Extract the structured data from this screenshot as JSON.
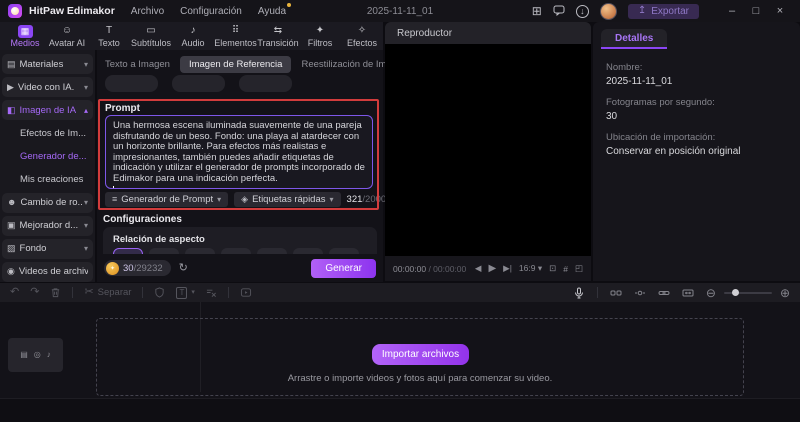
{
  "titlebar": {
    "app_name": "HitPaw Edimakor",
    "menu_archivo": "Archivo",
    "menu_configuracion": "Configuración",
    "menu_ayuda": "Ayuda",
    "document_title": "2025-11-11_01",
    "export_label": "Exportar"
  },
  "ribbon": {
    "tabs": [
      {
        "label": "Medios",
        "icon": "▦"
      },
      {
        "label": "Avatar AI",
        "icon": "☺"
      },
      {
        "label": "Texto",
        "icon": "T"
      },
      {
        "label": "Subtítulos",
        "icon": "▭"
      },
      {
        "label": "Audio",
        "icon": "♪"
      },
      {
        "label": "Elementos",
        "icon": "⠿"
      },
      {
        "label": "Transición",
        "icon": "⇆"
      },
      {
        "label": "Filtros",
        "icon": "✦"
      },
      {
        "label": "Efectos",
        "icon": "✧"
      }
    ]
  },
  "sidebar": {
    "items": [
      {
        "label": "Materiales",
        "icon": "▤",
        "caret": "▾"
      },
      {
        "label": "Video con IA.",
        "icon": "▶",
        "caret": "▾"
      },
      {
        "label": "Imagen de IA",
        "icon": "◧",
        "caret": "▴"
      },
      {
        "label": "Efectos de Im..."
      },
      {
        "label": "Generador de..."
      },
      {
        "label": "Mis creaciones"
      },
      {
        "label": "Cambio de ro...",
        "icon": "☻",
        "caret": "▾"
      },
      {
        "label": "Mejorador d...",
        "icon": "▣",
        "caret": "▾"
      },
      {
        "label": "Fondo",
        "icon": "▨",
        "caret": "▾"
      },
      {
        "label": "Videos de archivo",
        "icon": "◉"
      }
    ]
  },
  "media_panel": {
    "subtab_texto": "Texto a Imagen",
    "subtab_referencia": "Imagen de Referencia",
    "subtab_reestilizacion": "Reestilización de Imag...",
    "prompt_title": "Prompt",
    "prompt_text": "Una hermosa escena iluminada suavemente de una pareja disfrutando de un beso. Fondo: una playa al atardecer con un horizonte brillante. Para efectos más realistas e impresionantes, también puedes añadir etiquetas de indicación y utilizar el generador de prompts incorporado de Edimakor para una indicación perfecta.",
    "generator_button": "Generador de Prompt",
    "tags_button": "Etiquetas rápidas",
    "char_count": "321",
    "char_limit": "/2000",
    "settings_title": "Configuraciones",
    "aspect_label": "Relación de aspecto",
    "credits": "30",
    "credits_total": "/29232",
    "generate_label": "Generar"
  },
  "player": {
    "title": "Reproductor",
    "current_time": "00:00:00",
    "duration": " / 00:00:00",
    "ratio_label": "16:9"
  },
  "details": {
    "tab_label": "Detalles",
    "fields": [
      {
        "label": "Nombre:",
        "value": "2025-11-11_01"
      },
      {
        "label": "Fotogramas por segundo:",
        "value": "30"
      },
      {
        "label": "Ubicación de importación:",
        "value": "Conservar en posición original"
      }
    ]
  },
  "timeline": {
    "separate_label": "Separar",
    "import_button": "Importar archivos",
    "drop_hint": "Arrastre o importe videos y fotos aquí para comenzar su video."
  },
  "icons": {
    "caret_down": "▾",
    "generator": "≡",
    "tags": "◈",
    "prev": "◀",
    "play": "▶",
    "next": "▶|",
    "snapshot": "⊡",
    "crop": "#",
    "fullscreen": "◰",
    "undo": "↶",
    "redo": "↷",
    "scissors": "✂",
    "text_tool": "T",
    "zoom_out": "⊖",
    "zoom_in": "⊕",
    "refresh": "↻",
    "export_arrow": "↥",
    "layout": "⊞",
    "download": "↓",
    "minimize": "–",
    "maximize": "□",
    "close": "×",
    "coin": "✦",
    "track_type": "▤",
    "track_eye": "◎",
    "track_audio": "♪"
  },
  "colors": {
    "accent": "#9b4df5",
    "annotation_red": "#d23c3c"
  }
}
